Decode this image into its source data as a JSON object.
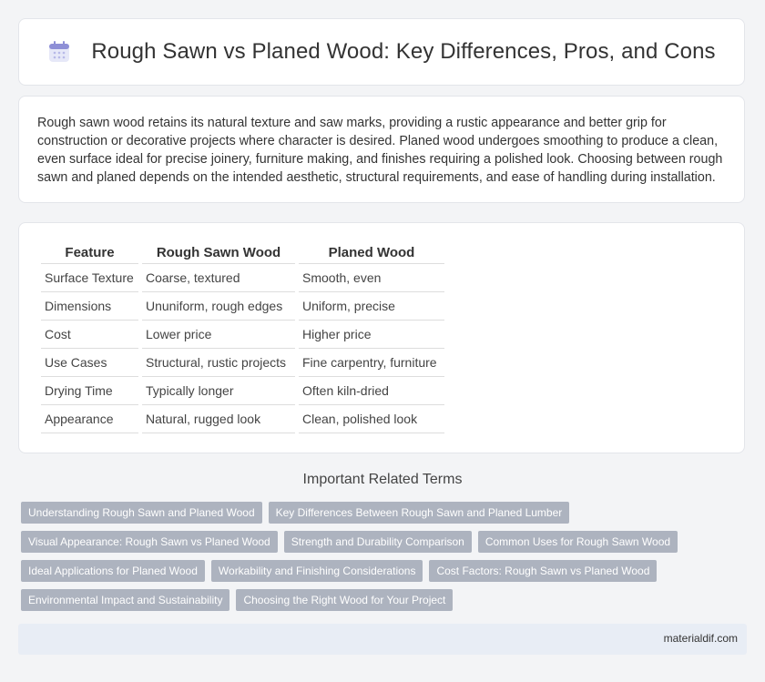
{
  "header": {
    "title": "Rough Sawn vs Planed Wood: Key Differences, Pros, and Cons",
    "icon": "calendar-icon"
  },
  "intro": {
    "text": "Rough sawn wood retains its natural texture and saw marks, providing a rustic appearance and better grip for construction or decorative projects where character is desired. Planed wood undergoes smoothing to produce a clean, even surface ideal for precise joinery, furniture making, and finishes requiring a polished look. Choosing between rough sawn and planed depends on the intended aesthetic, structural requirements, and ease of handling during installation."
  },
  "table": {
    "headers": [
      "Feature",
      "Rough Sawn Wood",
      "Planed Wood"
    ],
    "rows": [
      [
        "Surface Texture",
        "Coarse, textured",
        "Smooth, even"
      ],
      [
        "Dimensions",
        "Ununiform, rough edges",
        "Uniform, precise"
      ],
      [
        "Cost",
        "Lower price",
        "Higher price"
      ],
      [
        "Use Cases",
        "Structural, rustic projects",
        "Fine carpentry, furniture"
      ],
      [
        "Drying Time",
        "Typically longer",
        "Often kiln-dried"
      ],
      [
        "Appearance",
        "Natural, rugged look",
        "Clean, polished look"
      ]
    ]
  },
  "related": {
    "heading": "Important Related Terms",
    "tag_rows": [
      [
        "Understanding Rough Sawn and Planed Wood",
        "Key Differences Between Rough Sawn and Planed Lumber"
      ],
      [
        "Visual Appearance: Rough Sawn vs Planed Wood",
        "Strength and Durability Comparison",
        "Common Uses for Rough Sawn Wood"
      ],
      [
        "Ideal Applications for Planed Wood",
        "Workability and Finishing Considerations",
        "Cost Factors: Rough Sawn vs Planed Wood"
      ],
      [
        "Environmental Impact and Sustainability",
        "Choosing the Right Wood for Your Project"
      ]
    ]
  },
  "footer": {
    "site": "materialdif.com"
  },
  "colors": {
    "tag_bg": "#adb3bf",
    "footer_bg": "#e8edf5",
    "icon_accent": "#8e8fd6"
  }
}
